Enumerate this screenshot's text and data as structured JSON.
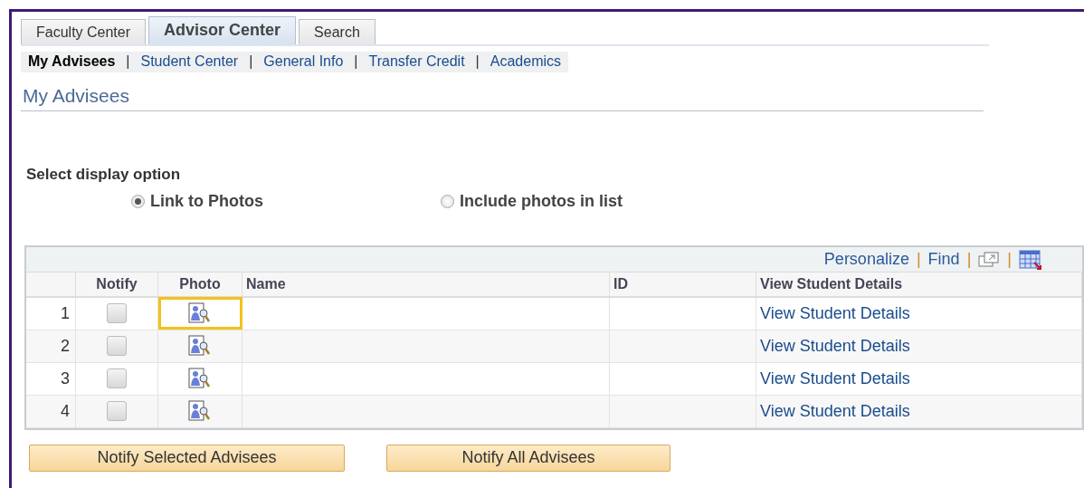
{
  "tabs": [
    {
      "label": "Faculty Center",
      "selected": false
    },
    {
      "label": "Advisor Center",
      "selected": true
    },
    {
      "label": "Search",
      "selected": false
    }
  ],
  "subnav": [
    {
      "label": "My Advisees",
      "selected": true
    },
    {
      "label": "Student Center",
      "selected": false
    },
    {
      "label": "General Info",
      "selected": false
    },
    {
      "label": "Transfer Credit",
      "selected": false
    },
    {
      "label": "Academics",
      "selected": false
    }
  ],
  "separator": "|",
  "page_title": "My Advisees",
  "display_option": {
    "label": "Select display option",
    "options": [
      {
        "label": "Link to Photos",
        "selected": true
      },
      {
        "label": "Include photos in list",
        "selected": false
      }
    ]
  },
  "grid": {
    "toolbar": {
      "personalize": "Personalize",
      "find": "Find",
      "separator": "|"
    },
    "columns": [
      "Notify",
      "Photo",
      "Name",
      "ID",
      "View Student Details"
    ],
    "rows": [
      {
        "number": "1",
        "checked": false,
        "highlighted": true,
        "link": "View Student Details"
      },
      {
        "number": "2",
        "checked": false,
        "highlighted": false,
        "link": "View Student Details"
      },
      {
        "number": "3",
        "checked": false,
        "highlighted": false,
        "link": "View Student Details"
      },
      {
        "number": "4",
        "checked": false,
        "highlighted": false,
        "link": "View Student Details"
      }
    ]
  },
  "buttons": [
    "Notify Selected Advisees",
    "Notify All Advisees"
  ]
}
